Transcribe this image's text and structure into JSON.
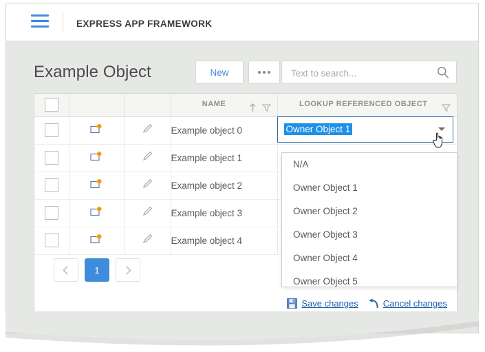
{
  "header": {
    "menu_icon": "hamburger-menu-icon",
    "app_title": "EXPRESS APP FRAMEWORK"
  },
  "toolbar": {
    "page_title": "Example Object",
    "new_label": "New",
    "more_label": "...",
    "search_placeholder": "Text to search...",
    "search_value": "",
    "search_icon": "search-icon"
  },
  "grid": {
    "columns": [
      {
        "key": "select",
        "label": ""
      },
      {
        "key": "open",
        "label": ""
      },
      {
        "key": "edit",
        "label": ""
      },
      {
        "key": "name",
        "label": "NAME",
        "sort": "ascending",
        "filter": true
      },
      {
        "key": "lookup",
        "label": "LOOKUP REFERENCED OBJECT",
        "filter": true
      }
    ],
    "rows": [
      {
        "name": "Example object 0",
        "lookup": "Owner Object 1",
        "editing": true
      },
      {
        "name": "Example object 1",
        "lookup": "",
        "editing": false
      },
      {
        "name": "Example object 2",
        "lookup": "",
        "editing": false
      },
      {
        "name": "Example object 3",
        "lookup": "",
        "editing": false
      },
      {
        "name": "Example object 4",
        "lookup": "",
        "editing": false
      }
    ]
  },
  "editor": {
    "selected_value": "Owner Object 1",
    "dropdown_open": true,
    "options": [
      "N/A",
      "Owner Object 1",
      "Owner Object 2",
      "Owner Object 3",
      "Owner Object 4",
      "Owner Object 5"
    ]
  },
  "pager": {
    "prev_label": "",
    "next_label": "",
    "pages": [
      "1"
    ],
    "current_page": "1"
  },
  "footer": {
    "save_label": "Save changes",
    "save_icon": "save-disk-icon",
    "cancel_label": "Cancel changes",
    "cancel_icon": "undo-arrow-icon"
  },
  "colors": {
    "accent_blue": "#3e8ddd",
    "selection_blue": "#1e90e8",
    "link_blue": "#1d5fa8",
    "page_background": "#e6e8e5",
    "header_row": "#f5f6f3",
    "text": "#5a5a5a"
  },
  "cursor": {
    "type": "pointing-hand"
  }
}
